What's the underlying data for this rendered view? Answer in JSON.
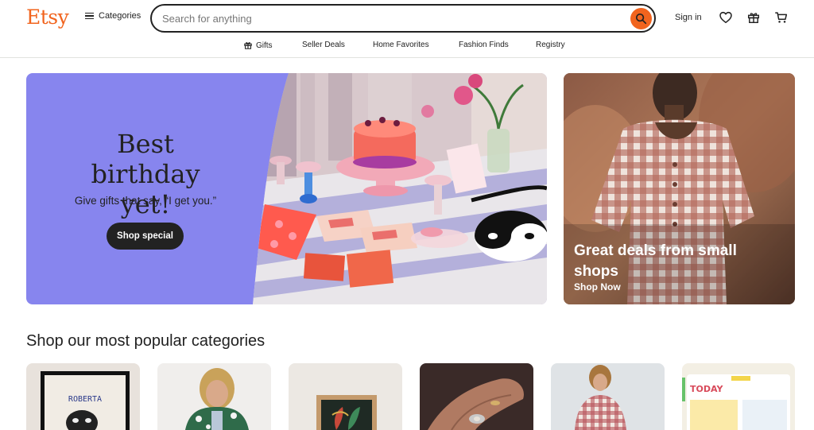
{
  "header": {
    "logo": "Etsy",
    "categories_label": "Categories",
    "search_placeholder": "Search for anything",
    "signin_label": "Sign in",
    "icons": [
      "search-icon",
      "heart-icon",
      "gift-icon",
      "cart-icon"
    ]
  },
  "nav": {
    "items": [
      {
        "label": "Gifts",
        "icon": "gift-icon"
      },
      {
        "label": "Seller Deals"
      },
      {
        "label": "Home Favorites"
      },
      {
        "label": "Fashion Finds"
      },
      {
        "label": "Registry"
      }
    ]
  },
  "hero": {
    "title_line1": "Best",
    "title_line2": "birthday yet!",
    "subtitle": "Give gifts that say, “I get you.”",
    "button": "Shop special",
    "bg_color": "#8785EE"
  },
  "side_card": {
    "title": "Great deals from small shops",
    "link": "Shop Now"
  },
  "categories": {
    "heading": "Shop our most popular categories",
    "tiles": [
      {
        "name": "poster-tile",
        "text": "ROBERTA"
      },
      {
        "name": "clothing-tile"
      },
      {
        "name": "art-tile"
      },
      {
        "name": "jewelry-tile"
      },
      {
        "name": "apparel-tile"
      },
      {
        "name": "planner-tile",
        "text": "TODAY"
      }
    ]
  },
  "colors": {
    "brand": "#F1641E",
    "text": "#222222",
    "divider": "#e1e3df"
  }
}
